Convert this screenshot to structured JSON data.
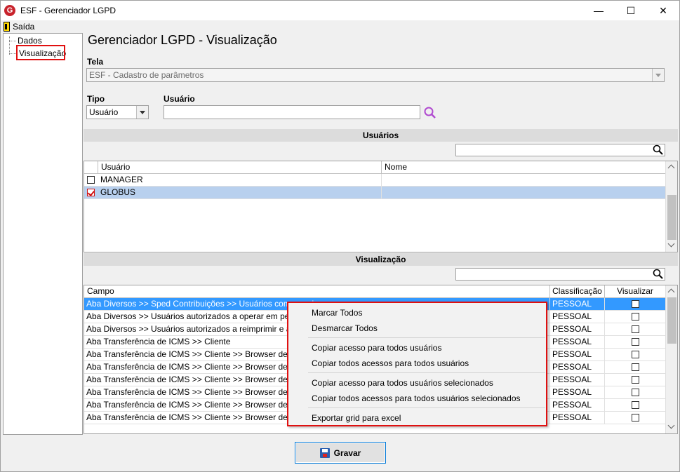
{
  "window": {
    "title": "ESF - Gerenciador LGPD",
    "app_icon": "G",
    "minimize": "—",
    "maximize": "☐",
    "close": "✕"
  },
  "menu": {
    "exit_label": "Saída"
  },
  "tree": {
    "items": [
      {
        "label": "Dados"
      },
      {
        "label": "Visualização"
      }
    ]
  },
  "main": {
    "title": "Gerenciador LGPD - Visualização",
    "tela_label": "Tela",
    "tela_value": "ESF - Cadastro de parâmetros",
    "tipo_label": "Tipo",
    "tipo_value": "Usuário",
    "usuario_label": "Usuário",
    "usuario_value": ""
  },
  "usuarios_section": {
    "title": "Usuários",
    "search_value": "",
    "columns": [
      "Usuário",
      "Nome"
    ],
    "rows": [
      {
        "usuario": "MANAGER",
        "nome": "",
        "checked": false
      },
      {
        "usuario": "GLOBUS",
        "nome": "",
        "checked": true
      }
    ]
  },
  "visualizacao_section": {
    "title": "Visualização",
    "search_value": "",
    "columns": [
      "Campo",
      "Classificação",
      "Visualizar"
    ],
    "rows": [
      {
        "campo": "Aba Diversos >> Sped Contribuições >> Usuários com permis",
        "classificacao": "PESSOAL"
      },
      {
        "campo": "Aba Diversos >> Usuários autorizados a operar em período fe",
        "classificacao": "PESSOAL"
      },
      {
        "campo": "Aba Diversos >> Usuários autorizados a reimprimir e alterar do",
        "classificacao": "PESSOAL"
      },
      {
        "campo": "Aba Transferência de ICMS >> Cliente",
        "classificacao": "PESSOAL"
      },
      {
        "campo": "Aba Transferência de ICMS >> Cliente >> Browser de pesqui",
        "classificacao": "PESSOAL"
      },
      {
        "campo": "Aba Transferência de ICMS >> Cliente >> Browser de pesqui",
        "classificacao": "PESSOAL"
      },
      {
        "campo": "Aba Transferência de ICMS >> Cliente >> Browser de pesqui",
        "classificacao": "PESSOAL"
      },
      {
        "campo": "Aba Transferência de ICMS >> Cliente >> Browser de pesqui",
        "classificacao": "PESSOAL"
      },
      {
        "campo": "Aba Transferência de ICMS >> Cliente >> Browser de pesqui",
        "classificacao": "PESSOAL"
      },
      {
        "campo": "Aba Transferência de ICMS >> Cliente >> Browser de pesqui",
        "classificacao": "PESSOAL"
      }
    ]
  },
  "context_menu": {
    "items": [
      "Marcar Todos",
      "Desmarcar Todos",
      "Copiar acesso para todos usuários",
      "Copiar todos acessos para todos usuários",
      "Copiar acesso para todos usuários selecionados",
      "Copiar todos acessos para todos usuários selecionados",
      "Exportar grid para excel"
    ]
  },
  "footer": {
    "save_label": "Gravar"
  },
  "colors": {
    "selection": "#3399ff",
    "highlight": "#e01010",
    "accent": "#0078d7"
  }
}
